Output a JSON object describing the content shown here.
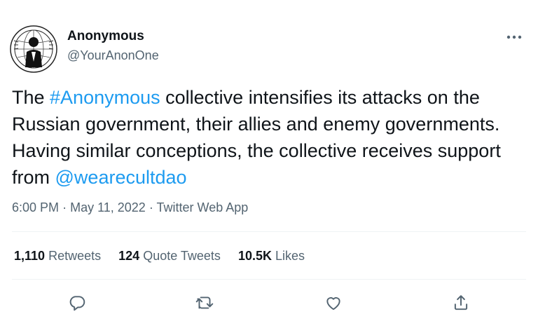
{
  "user": {
    "display_name": "Anonymous",
    "handle": "@YourAnonOne"
  },
  "tweet": {
    "segments": [
      {
        "text": "The ",
        "type": "text"
      },
      {
        "text": "#Anonymous",
        "type": "hashtag"
      },
      {
        "text": " collective intensifies its attacks on the Russian government, their allies and enemy governments. Having similar conceptions, the collective receives support from ",
        "type": "text"
      },
      {
        "text": "@wearecultdao",
        "type": "mention"
      }
    ],
    "time": "6:00 PM",
    "date": "May 11, 2022",
    "separator": "·",
    "platform": "Twitter Web App"
  },
  "stats": {
    "retweets_count": "1,110",
    "retweets_label": "Retweets",
    "quote_count": "124",
    "quote_label": "Quote Tweets",
    "likes_count": "10.5K",
    "likes_label": "Likes"
  },
  "icons": {
    "more": "more-dots-icon",
    "reply": "reply-icon",
    "retweet": "retweet-icon",
    "like": "heart-icon",
    "share": "share-icon"
  },
  "colors": {
    "link": "#1d9bf0",
    "text": "#0f1419",
    "secondary": "#536471",
    "divider": "#eff3f4"
  }
}
